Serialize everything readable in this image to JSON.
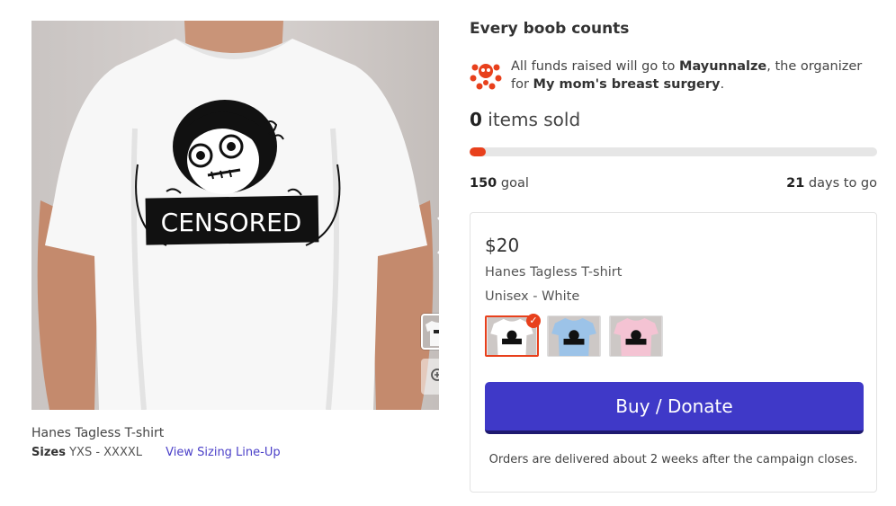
{
  "gallery": {
    "shirt_print_text": "CENSORED",
    "next_icon": "chevron-right-icon",
    "zoom_icon": "zoom-in-icon"
  },
  "product": {
    "name": "Hanes Tagless T-shirt",
    "sizes_label": "Sizes",
    "sizes_value": "YXS - XXXXL",
    "sizing_link": "View Sizing Line-Up"
  },
  "campaign": {
    "title": "Every boob counts",
    "funds_prefix": "All funds raised will go to ",
    "organizer": "Mayunnalze",
    "funds_middle": ", the organizer for ",
    "cause": "My mom's breast surgery",
    "funds_suffix": ".",
    "sold_count": "0",
    "sold_label": " items sold",
    "progress_fraction": 0.04,
    "goal_count": "150",
    "goal_label": " goal",
    "days_count": "21",
    "days_label": " days to go"
  },
  "card": {
    "price": "$20",
    "product": "Hanes Tagless T-shirt",
    "style": "Unisex - White",
    "swatches": [
      {
        "color": "#ffffff",
        "name": "White",
        "selected": true
      },
      {
        "color": "#9cc3e8",
        "name": "Light Blue",
        "selected": false
      },
      {
        "color": "#f4c3d3",
        "name": "Pink",
        "selected": false
      }
    ],
    "buy_label": "Buy / Donate",
    "delivery": "Orders are delivered about 2 weeks after the campaign closes."
  },
  "colors": {
    "accent": "#e8401c",
    "button": "#3f39c8",
    "link": "#4a3fc8"
  }
}
